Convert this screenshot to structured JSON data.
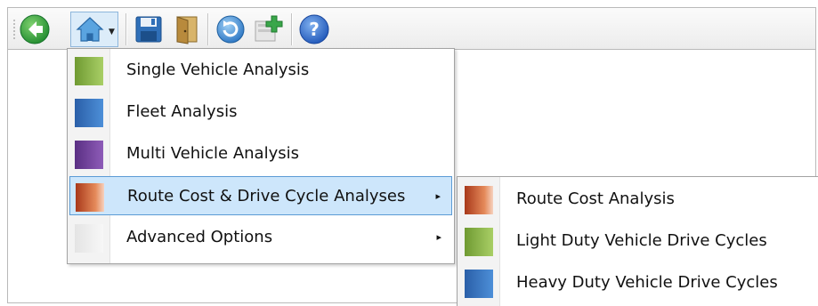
{
  "toolbar": {
    "buttons": [
      {
        "name": "back-icon",
        "color": "#2e9e3e"
      },
      {
        "name": "home-icon",
        "color": "#2f83d0"
      },
      {
        "name": "save-icon",
        "color": "#2f6fb8"
      },
      {
        "name": "door-icon",
        "color": "#b88a3c"
      },
      {
        "name": "refresh-icon",
        "color": "#2f83d0"
      },
      {
        "name": "add-icon",
        "color": "#3a9a3a"
      },
      {
        "name": "help-icon",
        "color": "#2f6fd0"
      }
    ]
  },
  "main_menu": {
    "items": [
      {
        "label": "Single Vehicle Analysis",
        "color": "#8db84a"
      },
      {
        "label": "Fleet Analysis",
        "color": "#3a7cc8"
      },
      {
        "label": "Multi Vehicle Analysis",
        "color": "#7c4ba3"
      },
      {
        "label": "Route Cost & Drive Cycle Analyses",
        "color": "#c85a2a",
        "submenu": true
      },
      {
        "label": "Advanced Options",
        "color": "#efefef",
        "submenu": true
      }
    ]
  },
  "sub_menu": {
    "items": [
      {
        "label": "Route Cost Analysis",
        "color": "#c85a2a"
      },
      {
        "label": "Light Duty Vehicle Drive Cycles",
        "color": "#8db84a"
      },
      {
        "label": "Heavy Duty Vehicle Drive Cycles",
        "color": "#3a7cc8"
      }
    ]
  },
  "submenu_arrow": "▸"
}
